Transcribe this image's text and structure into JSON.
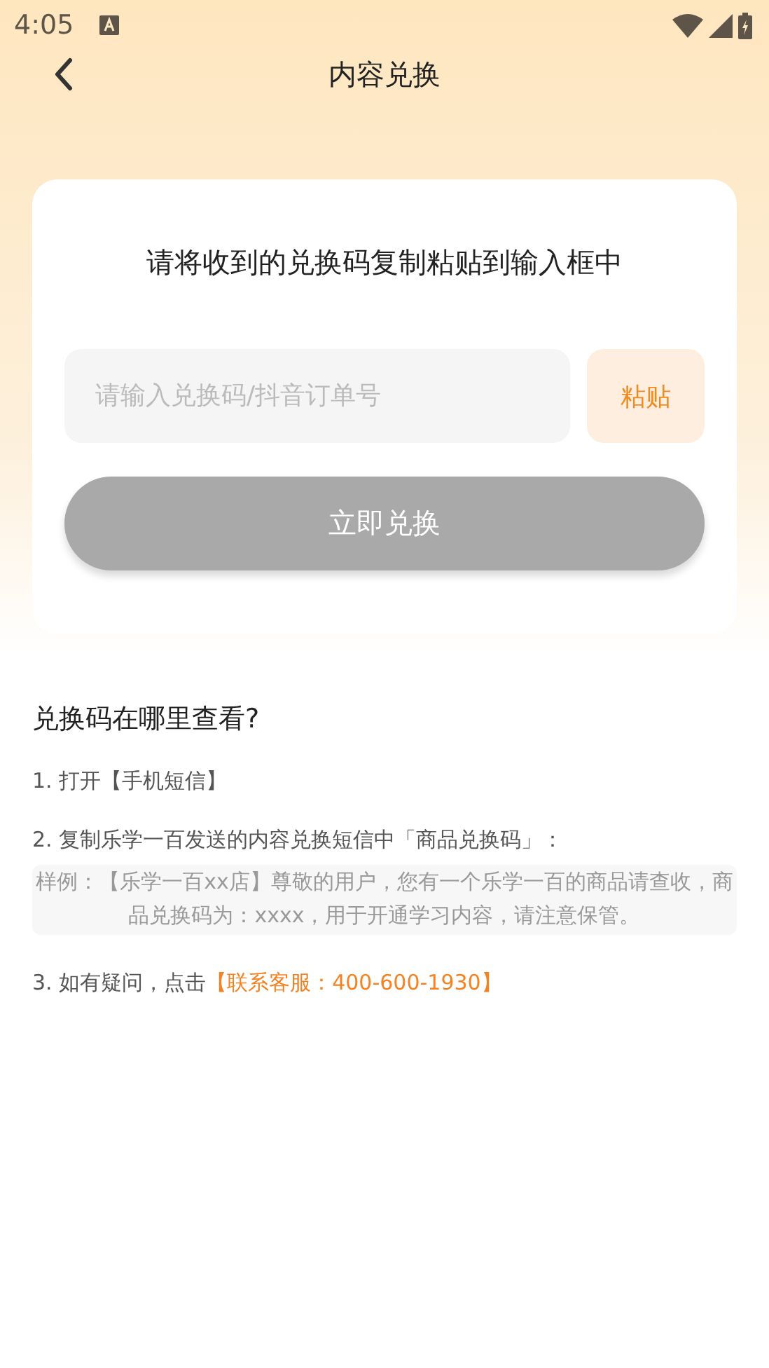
{
  "status_bar": {
    "time": "4:05"
  },
  "header": {
    "title": "内容兑换"
  },
  "card": {
    "instruction": "请将收到的兑换码复制粘贴到输入框中",
    "input": {
      "placeholder": "请输入兑换码/抖音订单号"
    },
    "paste_button": "粘贴",
    "redeem_button": {
      "label": "立即兑换",
      "disabled": true
    }
  },
  "help": {
    "heading": "兑换码在哪里查看?",
    "steps": [
      {
        "kind": "text",
        "text": "1. 打开【手机短信】"
      },
      {
        "kind": "text",
        "text": "2. 复制乐学一百发送的内容兑换短信中「商品兑换码」："
      },
      {
        "kind": "sample",
        "text": "样例：【乐学一百xx店】尊敬的用户，您有一个乐学一百的商品请查收，商品兑换码为：xxxx，用于开通学习内容，请注意保管。"
      },
      {
        "kind": "link",
        "text": "3. 如有疑问，点击",
        "link": "【联系客服：400-600-1930】"
      }
    ]
  }
}
